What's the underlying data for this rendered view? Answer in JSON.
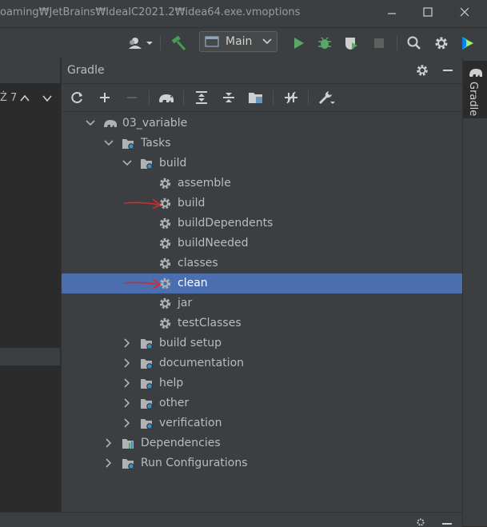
{
  "window": {
    "title": "oaming₩JetBrains₩IdeaIC2021.2₩idea64.exe.vmoptions"
  },
  "window_controls": [
    "minimize",
    "maximize",
    "close"
  ],
  "toolbar": {
    "run_config": "Main",
    "icons": [
      "user-icon",
      "build-hammer-icon",
      "run-icon",
      "debug-icon",
      "coverage-icon",
      "stop-icon",
      "search-icon",
      "settings-icon",
      "toolbox-icon"
    ]
  },
  "left_panel": {
    "fragment_text": "Ż 7"
  },
  "gradle_panel": {
    "title": "Gradle",
    "tab_label": "Gradle",
    "tree": [
      {
        "label": "03_variable",
        "depth": 0,
        "expanded": true,
        "icon": "gradle-elephant-icon"
      },
      {
        "label": "Tasks",
        "depth": 1,
        "expanded": true,
        "icon": "tasks-folder-icon"
      },
      {
        "label": "build",
        "depth": 2,
        "expanded": true,
        "icon": "tasks-folder-icon"
      },
      {
        "label": "assemble",
        "depth": 3,
        "icon": "gear-icon"
      },
      {
        "label": "build",
        "depth": 3,
        "icon": "gear-icon",
        "annotated": true
      },
      {
        "label": "buildDependents",
        "depth": 3,
        "icon": "gear-icon"
      },
      {
        "label": "buildNeeded",
        "depth": 3,
        "icon": "gear-icon"
      },
      {
        "label": "classes",
        "depth": 3,
        "icon": "gear-icon"
      },
      {
        "label": "clean",
        "depth": 3,
        "icon": "gear-icon",
        "selected": true,
        "annotated": true
      },
      {
        "label": "jar",
        "depth": 3,
        "icon": "gear-icon"
      },
      {
        "label": "testClasses",
        "depth": 3,
        "icon": "gear-icon"
      },
      {
        "label": "build setup",
        "depth": 2,
        "expanded": false,
        "icon": "tasks-folder-icon"
      },
      {
        "label": "documentation",
        "depth": 2,
        "expanded": false,
        "icon": "tasks-folder-icon"
      },
      {
        "label": "help",
        "depth": 2,
        "expanded": false,
        "icon": "tasks-folder-icon"
      },
      {
        "label": "other",
        "depth": 2,
        "expanded": false,
        "icon": "tasks-folder-icon"
      },
      {
        "label": "verification",
        "depth": 2,
        "expanded": false,
        "icon": "tasks-folder-icon"
      },
      {
        "label": "Dependencies",
        "depth": 1,
        "expanded": false,
        "icon": "dependencies-icon"
      },
      {
        "label": "Run Configurations",
        "depth": 1,
        "expanded": false,
        "icon": "run-configs-icon"
      }
    ]
  },
  "colors": {
    "selection": "#4b6eaf",
    "annotation_arrow": "#d12b2b",
    "run_green": "#59a869",
    "build_green": "#499c54"
  }
}
